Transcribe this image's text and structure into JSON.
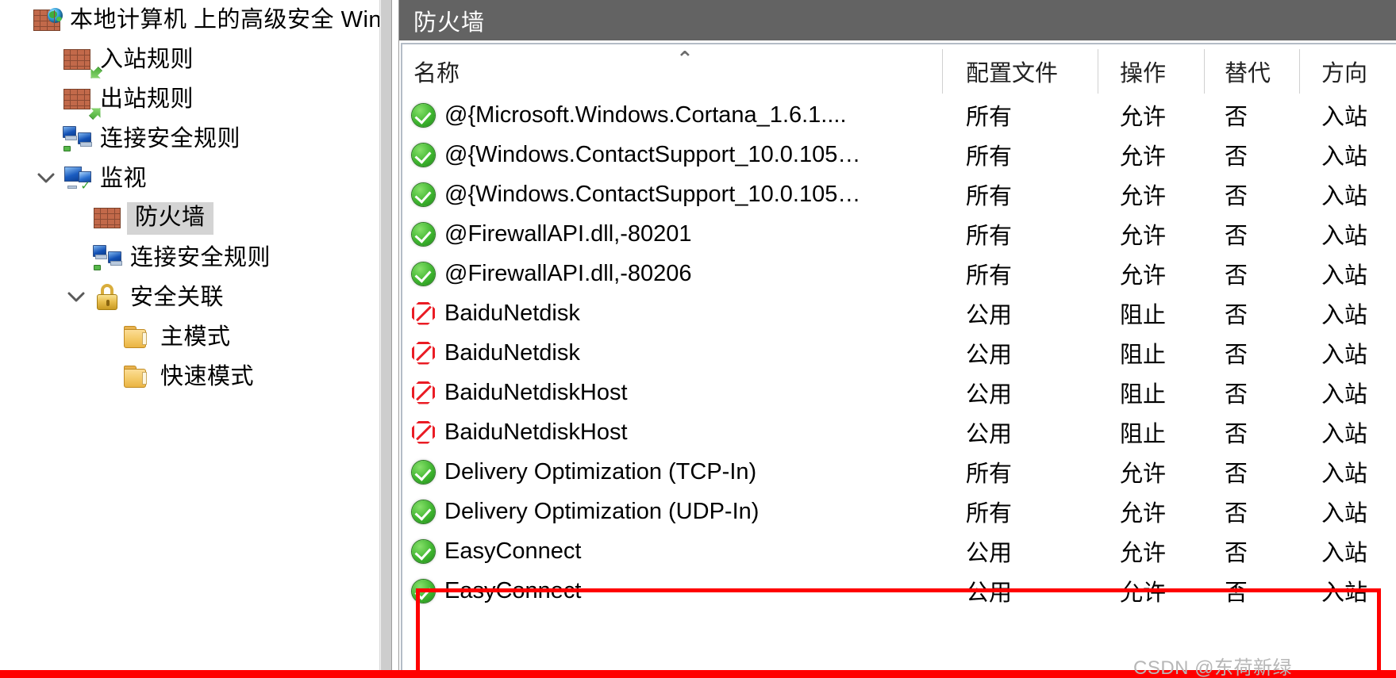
{
  "window": {
    "root_node_label": "本地计算机 上的高级安全 Win…"
  },
  "sidebar": {
    "scrollbar_present": true,
    "items": [
      {
        "label": "本地计算机 上的高级安全 Win…",
        "icon": "brick-wall-globe-icon",
        "depth": 0,
        "twisty": "none",
        "selected": false
      },
      {
        "label": "入站规则",
        "icon": "inbound-rules-icon",
        "depth": 1,
        "twisty": "none",
        "selected": false
      },
      {
        "label": "出站规则",
        "icon": "outbound-rules-icon",
        "depth": 1,
        "twisty": "none",
        "selected": false
      },
      {
        "label": "连接安全规则",
        "icon": "connection-security-rules-icon",
        "depth": 1,
        "twisty": "none",
        "selected": false
      },
      {
        "label": "监视",
        "icon": "monitoring-icon",
        "depth": 1,
        "twisty": "expanded",
        "selected": false
      },
      {
        "label": "防火墙",
        "icon": "firewall-brick-icon",
        "depth": 2,
        "twisty": "none",
        "selected": true
      },
      {
        "label": "连接安全规则",
        "icon": "connection-security-rules-icon",
        "depth": 2,
        "twisty": "none",
        "selected": false
      },
      {
        "label": "安全关联",
        "icon": "padlock-icon",
        "depth": 2,
        "twisty": "expanded",
        "selected": false
      },
      {
        "label": "主模式",
        "icon": "folder-icon",
        "depth": 3,
        "twisty": "none",
        "selected": false
      },
      {
        "label": "快速模式",
        "icon": "folder-icon",
        "depth": 3,
        "twisty": "none",
        "selected": false
      }
    ]
  },
  "main": {
    "pane_title": "防火墙",
    "sort_indicator": "⌃",
    "columns": [
      {
        "key": "name",
        "label": "名称"
      },
      {
        "key": "profile",
        "label": "配置文件"
      },
      {
        "key": "action",
        "label": "操作"
      },
      {
        "key": "override",
        "label": "替代"
      },
      {
        "key": "direction",
        "label": "方向"
      }
    ],
    "rows": [
      {
        "icon": "allow-icon",
        "name": "@{Microsoft.Windows.Cortana_1.6.1....",
        "profile": "所有",
        "action": "允许",
        "override": "否",
        "direction": "入站",
        "highlighted": false
      },
      {
        "icon": "allow-icon",
        "name": "@{Windows.ContactSupport_10.0.105…",
        "profile": "所有",
        "action": "允许",
        "override": "否",
        "direction": "入站",
        "highlighted": false
      },
      {
        "icon": "allow-icon",
        "name": "@{Windows.ContactSupport_10.0.105…",
        "profile": "所有",
        "action": "允许",
        "override": "否",
        "direction": "入站",
        "highlighted": false
      },
      {
        "icon": "allow-icon",
        "name": "@FirewallAPI.dll,-80201",
        "profile": "所有",
        "action": "允许",
        "override": "否",
        "direction": "入站",
        "highlighted": false
      },
      {
        "icon": "allow-icon",
        "name": "@FirewallAPI.dll,-80206",
        "profile": "所有",
        "action": "允许",
        "override": "否",
        "direction": "入站",
        "highlighted": false
      },
      {
        "icon": "block-icon",
        "name": "BaiduNetdisk",
        "profile": "公用",
        "action": "阻止",
        "override": "否",
        "direction": "入站",
        "highlighted": false
      },
      {
        "icon": "block-icon",
        "name": "BaiduNetdisk",
        "profile": "公用",
        "action": "阻止",
        "override": "否",
        "direction": "入站",
        "highlighted": false
      },
      {
        "icon": "block-icon",
        "name": "BaiduNetdiskHost",
        "profile": "公用",
        "action": "阻止",
        "override": "否",
        "direction": "入站",
        "highlighted": false
      },
      {
        "icon": "block-icon",
        "name": "BaiduNetdiskHost",
        "profile": "公用",
        "action": "阻止",
        "override": "否",
        "direction": "入站",
        "highlighted": false
      },
      {
        "icon": "allow-icon",
        "name": "Delivery Optimization (TCP-In)",
        "profile": "所有",
        "action": "允许",
        "override": "否",
        "direction": "入站",
        "highlighted": false
      },
      {
        "icon": "allow-icon",
        "name": "Delivery Optimization (UDP-In)",
        "profile": "所有",
        "action": "允许",
        "override": "否",
        "direction": "入站",
        "highlighted": false
      },
      {
        "icon": "allow-icon",
        "name": "EasyConnect",
        "profile": "公用",
        "action": "允许",
        "override": "否",
        "direction": "入站",
        "highlighted": true
      },
      {
        "icon": "allow-icon",
        "name": "EasyConnect",
        "profile": "公用",
        "action": "允许",
        "override": "否",
        "direction": "入站",
        "highlighted": true
      }
    ]
  },
  "annotation": {
    "color": "#ff0000",
    "shape": "rectangle-outline"
  },
  "watermark": {
    "text": "CSDN @东荷新绿"
  },
  "colors": {
    "title_bar_bg": "#636363",
    "selection_bg": "#d4d4d4",
    "allow_green": "#3fb52f",
    "block_red": "#ea1c24",
    "annotation_red": "#ff0000",
    "watermark_gray": "#b7b7b7"
  }
}
